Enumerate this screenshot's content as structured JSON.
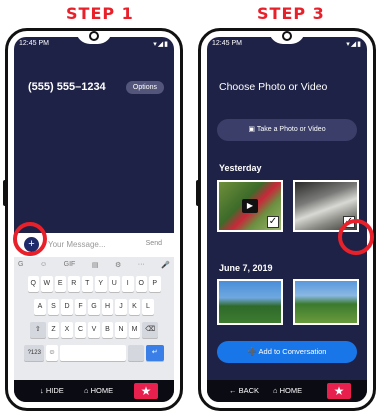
{
  "steps": {
    "left": "STEP 1",
    "right": "STEP 3"
  },
  "status": {
    "time": "12:45 PM",
    "icons": "▾◢▮"
  },
  "phone1": {
    "phone_number": "(555) 555–1234",
    "options_label": "Options",
    "compose": {
      "plus": "+",
      "placeholder": "Your Message...",
      "send_label": "Send"
    },
    "keyboard": {
      "toolbar": [
        "G",
        "☺",
        "GIF",
        "▤",
        "⚙",
        "···",
        "🎤"
      ],
      "row1": [
        "Q",
        "W",
        "E",
        "R",
        "T",
        "Y",
        "U",
        "I",
        "O",
        "P"
      ],
      "row2": [
        "A",
        "S",
        "D",
        "F",
        "G",
        "H",
        "J",
        "K",
        "L"
      ],
      "row3": [
        "⇧",
        "Z",
        "X",
        "C",
        "V",
        "B",
        "N",
        "M",
        "⌫"
      ],
      "row4": {
        "sym": "?123",
        "emoji": "☺",
        "enter": "↵"
      }
    },
    "nav": {
      "hide_label": "↓ HIDE",
      "home_label": "⌂ HOME",
      "star": "★"
    }
  },
  "phone2": {
    "title": "Choose Photo or Video",
    "take_photo_label": "Take a Photo or Video",
    "section_yesterday": "Yesterday",
    "section_june": "June 7, 2019",
    "add_label": "Add to Conversation",
    "check_mark": "✓",
    "play_icon": "▶",
    "nav": {
      "back_label": "← BACK",
      "home_label": "⌂ HOME",
      "star": "★"
    }
  },
  "colors": {
    "accent_red": "#e8202a",
    "screen_bg": "#1f2247",
    "blue": "#1976e8",
    "star_pink": "#e8204e"
  }
}
